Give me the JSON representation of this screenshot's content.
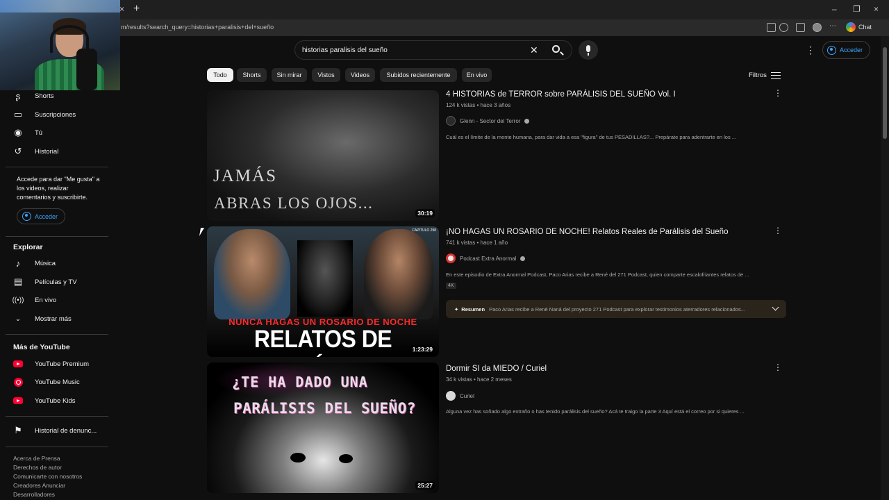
{
  "browser": {
    "url": "m/results?search_query=historias+paralisis+del+sueño",
    "new_tab": "+",
    "close_tab": "×",
    "chat_label": "Chat",
    "win_min": "–",
    "win_max": "❐",
    "win_close": "×"
  },
  "sidebar": {
    "items_top": [
      {
        "label": "Shorts",
        "icon": "shorts-icon"
      },
      {
        "label": "Suscripciones",
        "icon": "subscriptions-icon"
      },
      {
        "label": "Tú",
        "icon": "you-icon"
      },
      {
        "label": "Historial",
        "icon": "history-icon"
      }
    ],
    "signin_text": "Accede para dar \"Me gusta\" a los videos, realizar comentarios y suscribirte.",
    "signin_button": "Acceder",
    "explore_heading": "Explorar",
    "explore_items": [
      {
        "label": "Música",
        "icon": "music-icon"
      },
      {
        "label": "Películas y TV",
        "icon": "movies-icon"
      },
      {
        "label": "En vivo",
        "icon": "live-icon"
      },
      {
        "label": "Mostrar más",
        "icon": "chevron-down-icon"
      }
    ],
    "more_heading": "Más de YouTube",
    "more_items": [
      {
        "label": "YouTube Premium",
        "icon": "youtube-premium-icon"
      },
      {
        "label": "YouTube Music",
        "icon": "youtube-music-icon"
      },
      {
        "label": "YouTube Kids",
        "icon": "youtube-kids-icon"
      }
    ],
    "report_history": "Historial de denunc...",
    "footer": [
      "Acerca de  Prensa",
      "Derechos de autor",
      "Comunicarte con nosotros",
      "Creadores  Anunciar",
      "Desarrolladores"
    ]
  },
  "header": {
    "search_query": "historias paralisis del sueño",
    "signin_button": "Acceder"
  },
  "chips": [
    "Todo",
    "Shorts",
    "Sin mirar",
    "Vistos",
    "Videos",
    "Subidos recientemente",
    "En vivo"
  ],
  "filters_label": "Filtros",
  "videos": [
    {
      "title": "4 HISTORIAS de TERROR sobre PARÁLISIS DEL SUEÑO Vol. I",
      "meta": "124 k vistas • hace 3 años",
      "channel": "Glenn - Sector del Terror",
      "description": "Cuál es el límite de la mente humana, para dar vida a esa \"figura\" de tus PESADILLAS?... Prepárate para adentrarte en los ...",
      "duration": "30:19",
      "thumb_line1": "JAMÁS",
      "thumb_line2": "ABRAS LOS OJOS..."
    },
    {
      "title": "¡NO HAGAS UN ROSARIO DE NOCHE! Relatos Reales de Parálisis del Sueño",
      "meta": "741 k vistas • hace 1 año",
      "channel": "Podcast Extra Anormal",
      "description": "En este episodio de Extra Anormal Podcast, Paco Arias recibe a René del 271 Podcast, quien comparte escalofriantes relatos de ...",
      "badge": "4K",
      "duration": "1:23:29",
      "thumb_line1": "NUNCA HAGAS UN ROSARIO DE NOCHE",
      "thumb_line2": "RELATOS DE PARÁLISIS",
      "thumb_tag": "CAPÍTULO 298",
      "summary_label": "Resumen",
      "summary_text": "Paco Arias recibe a René Naná del proyecto 271 Podcast para explorar testimonios aterradores relacionados..."
    },
    {
      "title": "Dormir SI da MIEDO / Curiel",
      "meta": "34 k vistas • hace 2 meses",
      "channel": "Curiel",
      "description": "Alguna vez has soñado algo extraño o has tenido parálisis del sueño? Acá te traigo la parte 3 Aquí está el correo por si quieres ...",
      "duration": "25:27",
      "thumb_line1": "¿TE HA DADO UNA",
      "thumb_line2": "PARÁLISIS DEL SUEÑO?"
    }
  ]
}
